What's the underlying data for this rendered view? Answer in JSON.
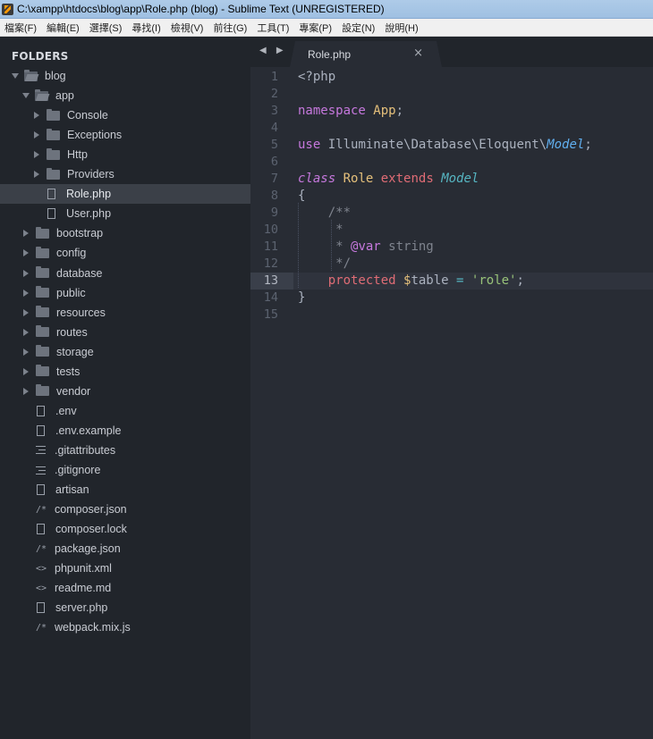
{
  "window": {
    "title": "C:\\xampp\\htdocs\\blog\\app\\Role.php (blog) - Sublime Text (UNREGISTERED)"
  },
  "menu": [
    "檔案(F)",
    "編輯(E)",
    "選擇(S)",
    "尋找(I)",
    "檢視(V)",
    "前往(G)",
    "工具(T)",
    "專案(P)",
    "設定(N)",
    "說明(H)"
  ],
  "sidebar": {
    "header": "FOLDERS",
    "items": [
      {
        "label": "blog",
        "kind": "folder-open",
        "depth": 0
      },
      {
        "label": "app",
        "kind": "folder-open",
        "depth": 1
      },
      {
        "label": "Console",
        "kind": "folder",
        "depth": 2
      },
      {
        "label": "Exceptions",
        "kind": "folder",
        "depth": 2
      },
      {
        "label": "Http",
        "kind": "folder",
        "depth": 2
      },
      {
        "label": "Providers",
        "kind": "folder",
        "depth": 2
      },
      {
        "label": "Role.php",
        "kind": "file",
        "depth": 2,
        "selected": true
      },
      {
        "label": "User.php",
        "kind": "file",
        "depth": 2
      },
      {
        "label": "bootstrap",
        "kind": "folder",
        "depth": 1
      },
      {
        "label": "config",
        "kind": "folder",
        "depth": 1
      },
      {
        "label": "database",
        "kind": "folder",
        "depth": 1
      },
      {
        "label": "public",
        "kind": "folder",
        "depth": 1
      },
      {
        "label": "resources",
        "kind": "folder",
        "depth": 1
      },
      {
        "label": "routes",
        "kind": "folder",
        "depth": 1
      },
      {
        "label": "storage",
        "kind": "folder",
        "depth": 1
      },
      {
        "label": "tests",
        "kind": "folder",
        "depth": 1
      },
      {
        "label": "vendor",
        "kind": "folder",
        "depth": 1
      },
      {
        "label": ".env",
        "kind": "file",
        "depth": 1
      },
      {
        "label": ".env.example",
        "kind": "file",
        "depth": 1
      },
      {
        "label": ".gitattributes",
        "kind": "lines",
        "depth": 1
      },
      {
        "label": ".gitignore",
        "kind": "lines",
        "depth": 1
      },
      {
        "label": "artisan",
        "kind": "file",
        "depth": 1
      },
      {
        "label": "composer.json",
        "kind": "json",
        "depth": 1
      },
      {
        "label": "composer.lock",
        "kind": "file",
        "depth": 1
      },
      {
        "label": "package.json",
        "kind": "json",
        "depth": 1
      },
      {
        "label": "phpunit.xml",
        "kind": "xml",
        "depth": 1
      },
      {
        "label": "readme.md",
        "kind": "xml",
        "depth": 1
      },
      {
        "label": "server.php",
        "kind": "file",
        "depth": 1
      },
      {
        "label": "webpack.mix.js",
        "kind": "json",
        "depth": 1
      }
    ]
  },
  "editor": {
    "nav": "◀ ▶",
    "tab": {
      "label": "Role.php",
      "close": "×"
    },
    "current_line": 13,
    "lines": [
      [
        [
          "c-plain",
          "<?php"
        ]
      ],
      [],
      [
        [
          "c-nsp",
          "namespace"
        ],
        [
          "c-plain",
          " "
        ],
        [
          "c-cname",
          "App"
        ],
        [
          "c-plain",
          ";"
        ]
      ],
      [],
      [
        [
          "c-kw",
          "use"
        ],
        [
          "c-plain",
          " Illuminate\\Database\\Eloquent\\"
        ],
        [
          "c-it",
          "Model"
        ],
        [
          "c-plain",
          ";"
        ]
      ],
      [],
      [
        [
          "c-cls-kw",
          "class"
        ],
        [
          "c-plain",
          " "
        ],
        [
          "c-cname",
          "Role"
        ],
        [
          "c-plain",
          " "
        ],
        [
          "c-ex",
          "extends"
        ],
        [
          "c-plain",
          " "
        ],
        [
          "c-cls",
          "Model"
        ]
      ],
      [
        [
          "c-plain",
          "{"
        ]
      ],
      [
        [
          "c-cm",
          "    /**"
        ]
      ],
      [
        [
          "c-cm",
          "     *"
        ]
      ],
      [
        [
          "c-cm",
          "     * "
        ],
        [
          "c-tag",
          "@var"
        ],
        [
          "c-cm",
          " string"
        ]
      ],
      [
        [
          "c-cm",
          "     */"
        ]
      ],
      [
        [
          "c-plain",
          "    "
        ],
        [
          "c-prot",
          "protected"
        ],
        [
          "c-plain",
          " "
        ],
        [
          "c-var",
          "$"
        ],
        [
          "c-plain",
          "table "
        ],
        [
          "c-op",
          "="
        ],
        [
          "c-plain",
          " "
        ],
        [
          "c-str",
          "'role'"
        ],
        [
          "c-plain",
          ";"
        ]
      ],
      [
        [
          "c-plain",
          "}"
        ]
      ],
      []
    ]
  }
}
